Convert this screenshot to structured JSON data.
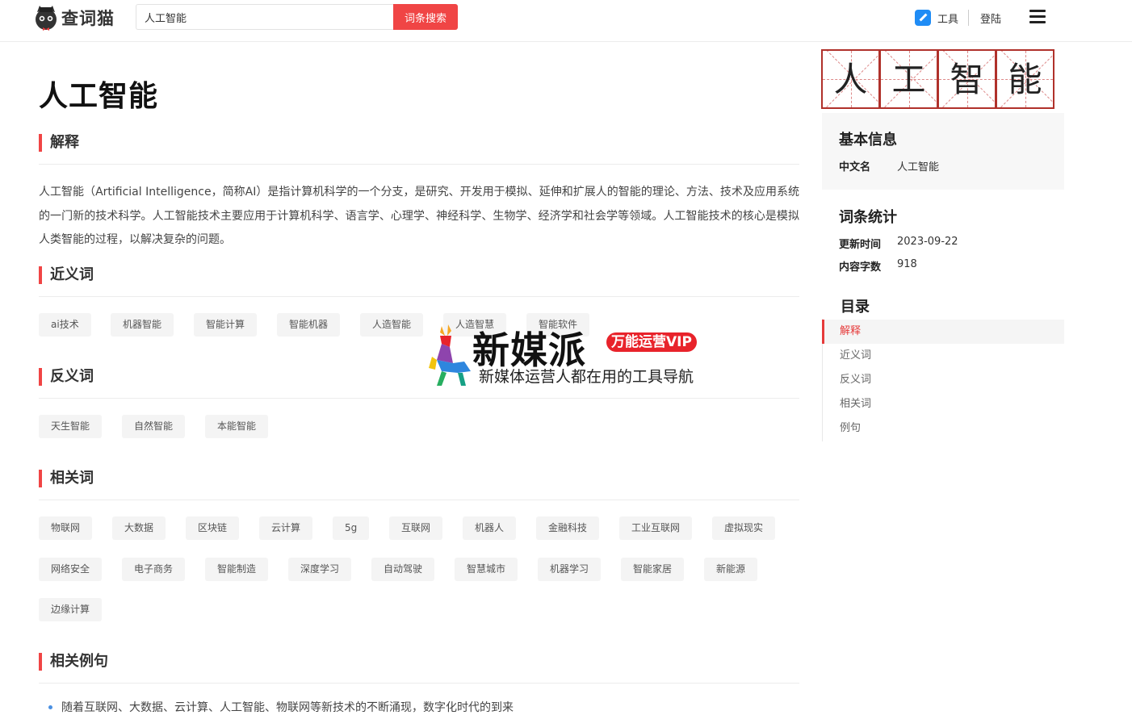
{
  "header": {
    "logo_text": "查词猫",
    "search_value": "人工智能",
    "search_button": "词条搜索",
    "tools_label": "工具",
    "login_label": "登陆"
  },
  "main": {
    "title": "人工智能",
    "sections": {
      "definition": "解释",
      "synonyms": "近义词",
      "antonyms": "反义词",
      "related": "相关词",
      "examples": "相关例句"
    },
    "definition_text": "人工智能（Artificial Intelligence，简称AI）是指计算机科学的一个分支，是研究、开发用于模拟、延伸和扩展人的智能的理论、方法、技术及应用系统的一门新的技术科学。人工智能技术主要应用于计算机科学、语言学、心理学、神经科学、生物学、经济学和社会学等领域。人工智能技术的核心是模拟人类智能的过程，以解决复杂的问题。",
    "synonyms": [
      "ai技术",
      "机器智能",
      "智能计算",
      "智能机器",
      "人造智能",
      "人造智慧",
      "智能软件"
    ],
    "antonyms": [
      "天生智能",
      "自然智能",
      "本能智能"
    ],
    "related": [
      "物联网",
      "大数据",
      "区块链",
      "云计算",
      "5g",
      "互联网",
      "机器人",
      "金融科技",
      "工业互联网",
      "虚拟现实",
      "网络安全",
      "电子商务",
      "智能制造",
      "深度学习",
      "自动驾驶",
      "智慧城市",
      "机器学习",
      "智能家居",
      "新能源",
      "边缘计算"
    ],
    "example_sentence": "随着互联网、大数据、云计算、人工智能、物联网等新技术的不断涌现，数字化时代的到来"
  },
  "sidebar": {
    "characters": [
      "人",
      "工",
      "智",
      "能"
    ],
    "basic_info_title": "基本信息",
    "chinese_name_key": "中文名",
    "chinese_name_val": "人工智能",
    "stats_title": "词条统计",
    "updated_key": "更新时间",
    "updated_val": "2023-09-22",
    "wordcount_key": "内容字数",
    "wordcount_val": "918",
    "toc_title": "目录",
    "toc": [
      "解释",
      "近义词",
      "反义词",
      "相关词",
      "例句"
    ]
  },
  "watermark": {
    "title": "新媒派",
    "badge": "万能运营VIP",
    "subtitle": "新媒体运营人都在用的工具导航"
  },
  "colors": {
    "accent": "#f04545",
    "char_border": "#b0312b",
    "tag_bg": "#f4f4f4"
  }
}
